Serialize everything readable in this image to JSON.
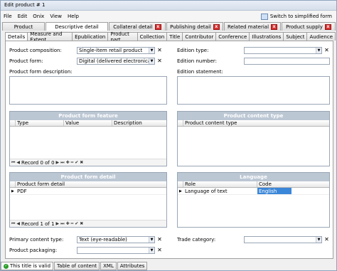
{
  "window": {
    "title": "Edit product # 1"
  },
  "menu": [
    "File",
    "Edit",
    "Onix",
    "View",
    "Help"
  ],
  "switch_label": "Switch to simplified form",
  "top_tabs": [
    {
      "label": "Product"
    },
    {
      "label": "Descriptive detail"
    },
    {
      "label": "Collateral detail"
    },
    {
      "label": "Publishing detail"
    },
    {
      "label": "Related material"
    },
    {
      "label": "Product supply"
    }
  ],
  "sub_tabs": [
    "Details",
    "Measure and Extent",
    "Epublication",
    "Product part",
    "Collection",
    "Title",
    "Contributor",
    "Conference",
    "Illustrations",
    "Subject",
    "Audience"
  ],
  "form": {
    "product_composition_label": "Product composition:",
    "product_composition_value": "Single-item retail product",
    "product_form_label": "Product form:",
    "product_form_value": "Digital (delivered electronically)",
    "product_form_description_label": "Product form description:",
    "edition_type_label": "Edition type:",
    "edition_number_label": "Edition number:",
    "edition_statement_label": "Edition statement:",
    "primary_content_type_label": "Primary content type:",
    "primary_content_type_value": "Text (eye-readable)",
    "product_packaging_label": "Product packaging:",
    "trade_category_label": "Trade category:"
  },
  "grids": {
    "feature": {
      "title": "Product form feature",
      "columns": [
        "Type",
        "Value",
        "Description"
      ],
      "footer": "Record 0 of 0"
    },
    "content_type": {
      "title": "Product content type",
      "columns": [
        "Product content type"
      ]
    },
    "form_detail": {
      "title": "Product form detail",
      "columns": [
        "Product form detail"
      ],
      "rows": [
        "PDF"
      ],
      "footer": "Record 1 of 1"
    },
    "language": {
      "title": "Language",
      "columns": [
        "Role",
        "Code"
      ],
      "rows": [
        {
          "role": "Language of text",
          "code": "English"
        }
      ]
    }
  },
  "status": {
    "valid": "This title is valid",
    "tabs": [
      "Table of content",
      "XML",
      "Attributes"
    ]
  }
}
